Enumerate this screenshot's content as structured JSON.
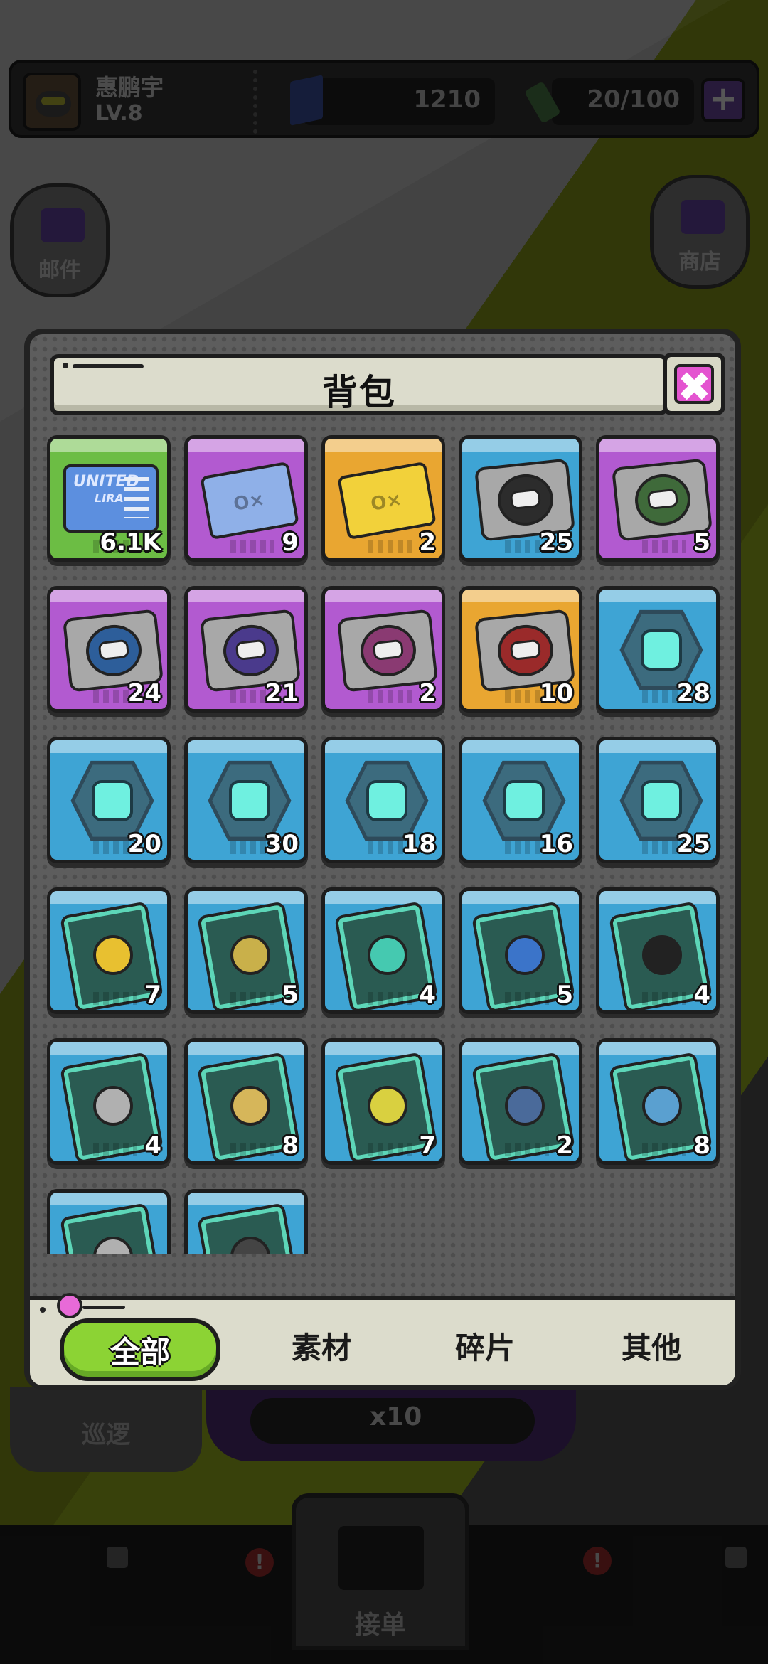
{
  "player": {
    "name": "惠鹏宇",
    "level": "LV.8"
  },
  "resources": {
    "gems": "1210",
    "energy": "20/100",
    "add": "+"
  },
  "side_buttons": {
    "mail": "邮件",
    "shop": "商店"
  },
  "bottom": {
    "patrol": "巡逻",
    "ten_pull": "x10",
    "accept_order": "接单"
  },
  "panel": {
    "title": "背包",
    "close": "✖"
  },
  "lira_card": {
    "brand_top": "UNITED",
    "brand_bottom": "LIRA"
  },
  "ticket_mark": "O×",
  "items": [
    {
      "kind": "lira",
      "bg": "green",
      "count": "6.1K"
    },
    {
      "kind": "ticket",
      "bg": "purple",
      "count": "9",
      "tint": "#8fb0e8"
    },
    {
      "kind": "ticket",
      "bg": "orange",
      "count": "2",
      "tint": "#f2d13a"
    },
    {
      "kind": "plate",
      "bg": "blue",
      "count": "25",
      "window": "#2c2c2c"
    },
    {
      "kind": "plate",
      "bg": "purple",
      "count": "5",
      "window": "#3f6a3a"
    },
    {
      "kind": "plate",
      "bg": "purple",
      "count": "24",
      "window": "#2d5e9a"
    },
    {
      "kind": "plate",
      "bg": "purple",
      "count": "21",
      "window": "#4a3a8c"
    },
    {
      "kind": "plate",
      "bg": "purple",
      "count": "2",
      "window": "#8a3a72"
    },
    {
      "kind": "plate",
      "bg": "orange",
      "count": "10",
      "window": "#9a2a2a"
    },
    {
      "kind": "hex",
      "bg": "blue",
      "count": "28"
    },
    {
      "kind": "hex",
      "bg": "blue",
      "count": "20"
    },
    {
      "kind": "hex",
      "bg": "blue",
      "count": "30"
    },
    {
      "kind": "hex",
      "bg": "blue",
      "count": "18"
    },
    {
      "kind": "hex",
      "bg": "blue",
      "count": "16"
    },
    {
      "kind": "hex",
      "bg": "blue",
      "count": "25"
    },
    {
      "kind": "card",
      "bg": "blue",
      "count": "7",
      "obj": "#e8c030"
    },
    {
      "kind": "card",
      "bg": "blue",
      "count": "5",
      "obj": "#c9b04a"
    },
    {
      "kind": "card",
      "bg": "blue",
      "count": "4",
      "obj": "#45c9b0"
    },
    {
      "kind": "card",
      "bg": "blue",
      "count": "5",
      "obj": "#3b74c9"
    },
    {
      "kind": "card",
      "bg": "blue",
      "count": "4",
      "obj": "#222222"
    },
    {
      "kind": "card",
      "bg": "blue",
      "count": "4",
      "obj": "#b0b0b0"
    },
    {
      "kind": "card",
      "bg": "blue",
      "count": "8",
      "obj": "#d6b65a"
    },
    {
      "kind": "card",
      "bg": "blue",
      "count": "7",
      "obj": "#d9d040"
    },
    {
      "kind": "card",
      "bg": "blue",
      "count": "2",
      "obj": "#4a6a9a"
    },
    {
      "kind": "card",
      "bg": "blue",
      "count": "8",
      "obj": "#5aa0d0"
    },
    {
      "kind": "card",
      "bg": "blue",
      "count": "",
      "obj": "#b0b0b0"
    },
    {
      "kind": "card",
      "bg": "blue",
      "count": "",
      "obj": "#444444"
    }
  ],
  "tabs": [
    {
      "label": "全部",
      "active": true
    },
    {
      "label": "素材",
      "active": false
    },
    {
      "label": "碎片",
      "active": false
    },
    {
      "label": "其他",
      "active": false
    }
  ],
  "colors": {
    "accent_green": "#8cd334",
    "close_pink": "#e454d0"
  }
}
